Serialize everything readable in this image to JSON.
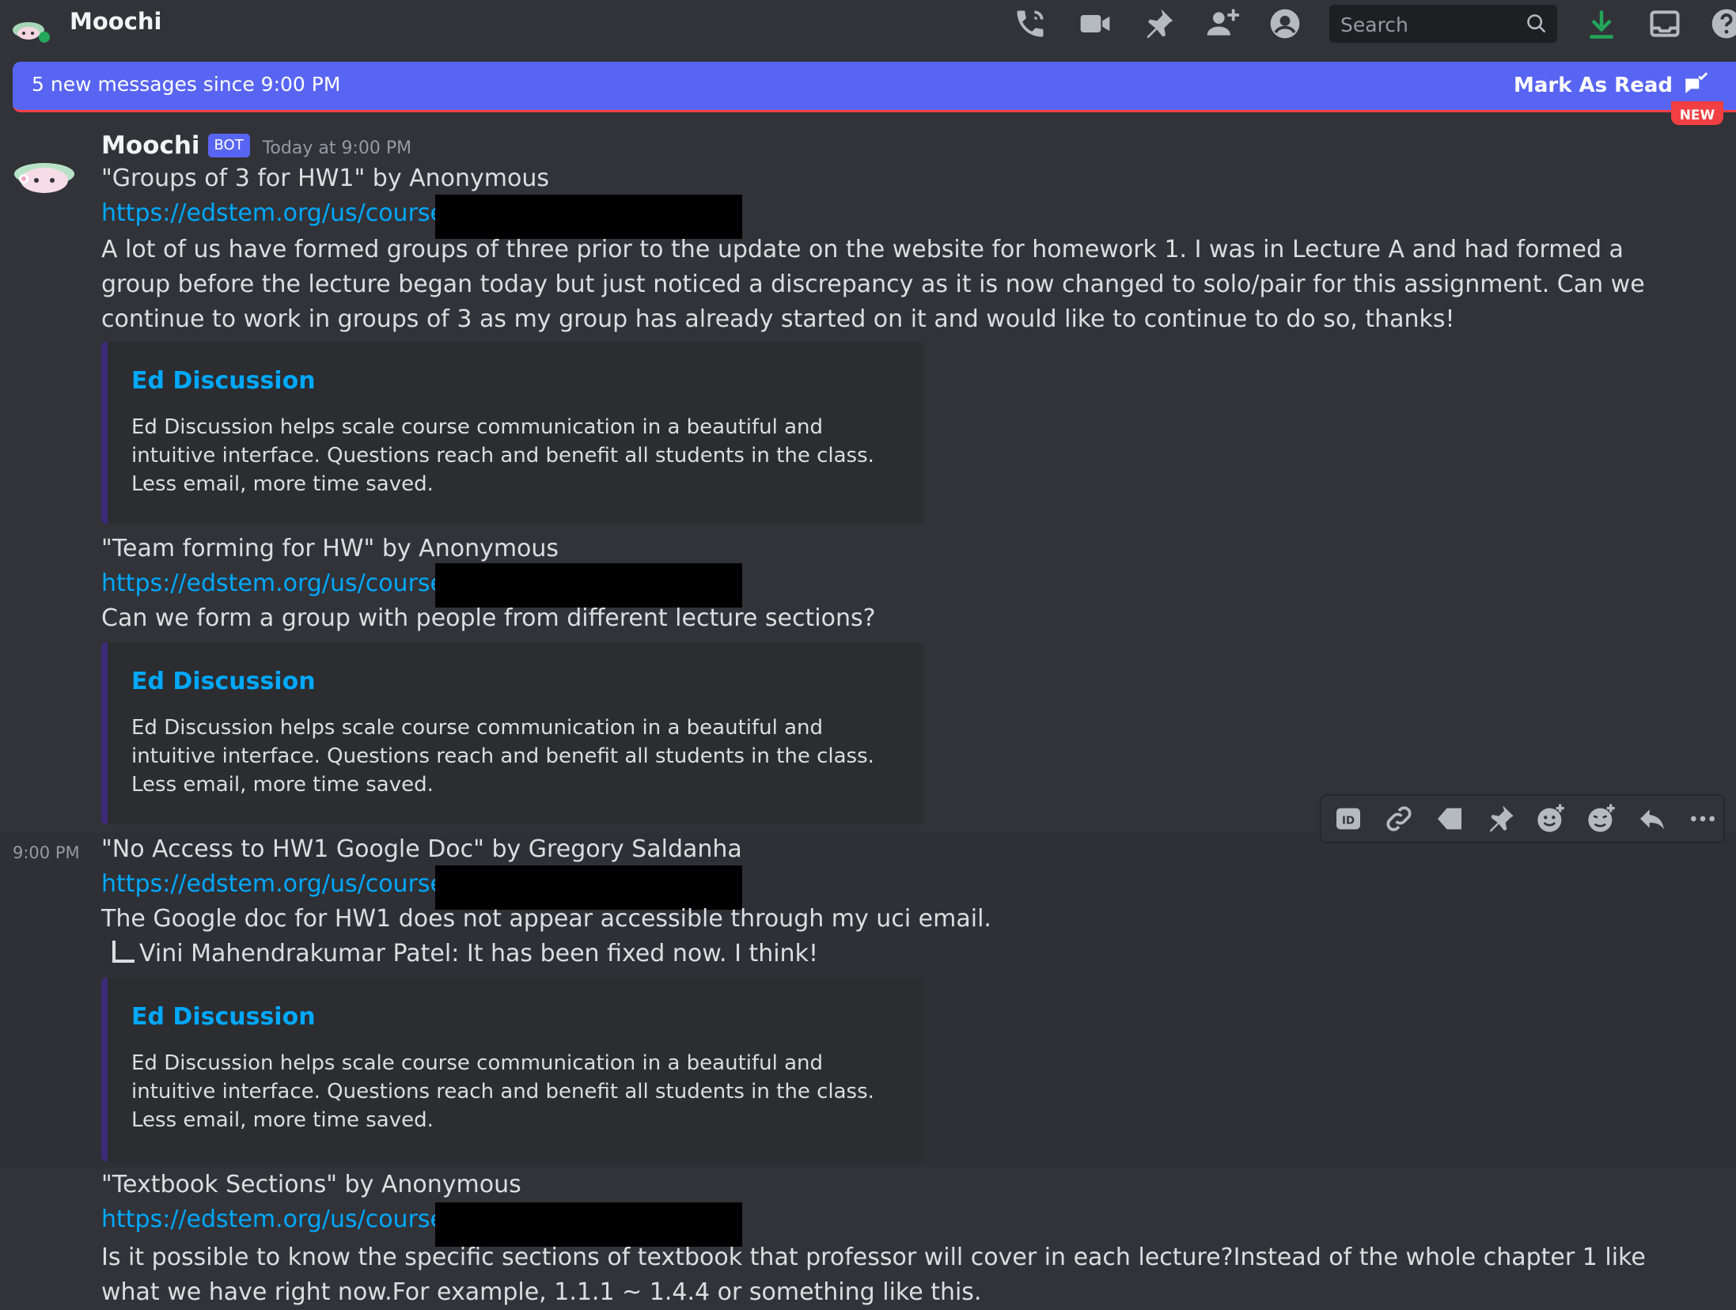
{
  "header": {
    "channel_name": "Moochi",
    "search_placeholder": "Search",
    "icons": [
      "threads-icon",
      "video-call-icon",
      "pin-icon",
      "add-member-icon",
      "member-list-icon",
      "search-icon",
      "download-icon",
      "inbox-icon",
      "help-icon"
    ]
  },
  "new_messages_bar": {
    "text": "5 new messages since 9:00 PM",
    "mark_read_label": "Mark As Read",
    "new_badge": "NEW"
  },
  "message": {
    "author": "Moochi",
    "bot_tag": "BOT",
    "timestamp": "Today at 9:00 PM",
    "side_timestamp": "9:00 PM"
  },
  "posts": [
    {
      "title": "\"Groups of 3 for HW1\" by Anonymous",
      "link": "https://edstem.org/us/courses/",
      "body": "A lot of us have formed groups of three prior to the update on the website for homework 1. I was in Lecture A and had formed a group before the lecture began today but just noticed a discrepancy as it is now changed to solo/pair for this assignment. Can we continue to work in groups of 3 as my group has already started on it and would like to continue to do so, thanks!",
      "embed_title": "Ed Discussion",
      "embed_desc": "Ed Discussion helps scale course communication in a beautiful and intuitive interface. Questions reach and benefit all students in the class. Less email, more time saved."
    },
    {
      "title": "\"Team forming for HW\" by Anonymous",
      "link": "https://edstem.org/us/courses/",
      "body": "Can we form a group with people from different lecture sections?",
      "embed_title": "Ed Discussion",
      "embed_desc": "Ed Discussion helps scale course communication in a beautiful and intuitive interface. Questions reach and benefit all students in the class. Less email, more time saved."
    },
    {
      "title": "\"No Access to HW1 Google Doc\" by Gregory Saldanha",
      "link": "https://edstem.org/us/courses/",
      "body": "The Google doc for HW1 does not appear accessible through my uci email.",
      "reply": "Vini Mahendrakumar Patel: It has been fixed now. I think!",
      "embed_title": "Ed Discussion",
      "embed_desc": "Ed Discussion helps scale course communication in a beautiful and intuitive interface. Questions reach and benefit all students in the class. Less email, more time saved."
    },
    {
      "title": "\"Textbook Sections\" by Anonymous",
      "link": "https://edstem.org/us/courses/",
      "body": "Is it possible to know the specific sections of textbook that professor will cover in each lecture?Instead of the whole chapter 1 like what we have right now.For example, 1.1.1 ~ 1.4.4 or something like this."
    }
  ],
  "action_bar": {
    "icons": [
      "app-id-icon",
      "copy-link-icon",
      "tag-icon",
      "pin-message-icon",
      "add-reaction-icon",
      "super-reaction-icon",
      "reply-icon",
      "more-icon"
    ]
  }
}
